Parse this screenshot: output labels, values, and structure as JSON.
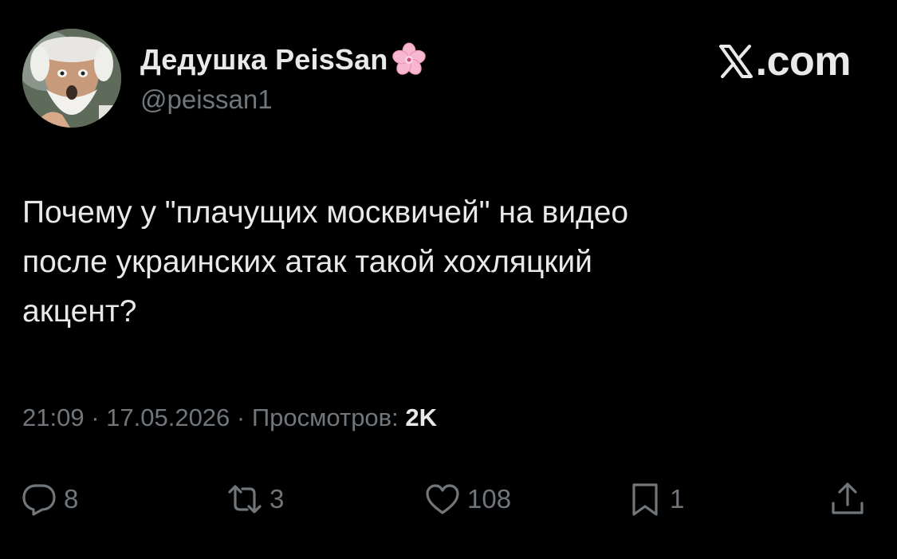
{
  "author": {
    "display_name": "Дедушка PeisSan",
    "name_emoji": "cherry-blossom-icon",
    "handle": "@peissan1"
  },
  "brand": {
    "label": ".com",
    "logo": "x-logo-icon"
  },
  "tweet": {
    "text": "Почему у \"плачущих москвичей\" на видео\nпосле украинских атак такой хохляцкий\nакцент?"
  },
  "meta": {
    "time": "21:09",
    "separator": " · ",
    "date": "17.05.2026",
    "views_label": "Просмотров: ",
    "views_count": "2K"
  },
  "actions": {
    "reply": {
      "icon": "reply-icon",
      "count": "8"
    },
    "retweet": {
      "icon": "retweet-icon",
      "count": "3"
    },
    "like": {
      "icon": "heart-icon",
      "count": "108"
    },
    "bookmark": {
      "icon": "bookmark-icon",
      "count": "1"
    },
    "share": {
      "icon": "share-icon"
    }
  },
  "colors": {
    "background": "#000000",
    "primary_text": "#e7e9ea",
    "secondary_text": "#71767b"
  }
}
